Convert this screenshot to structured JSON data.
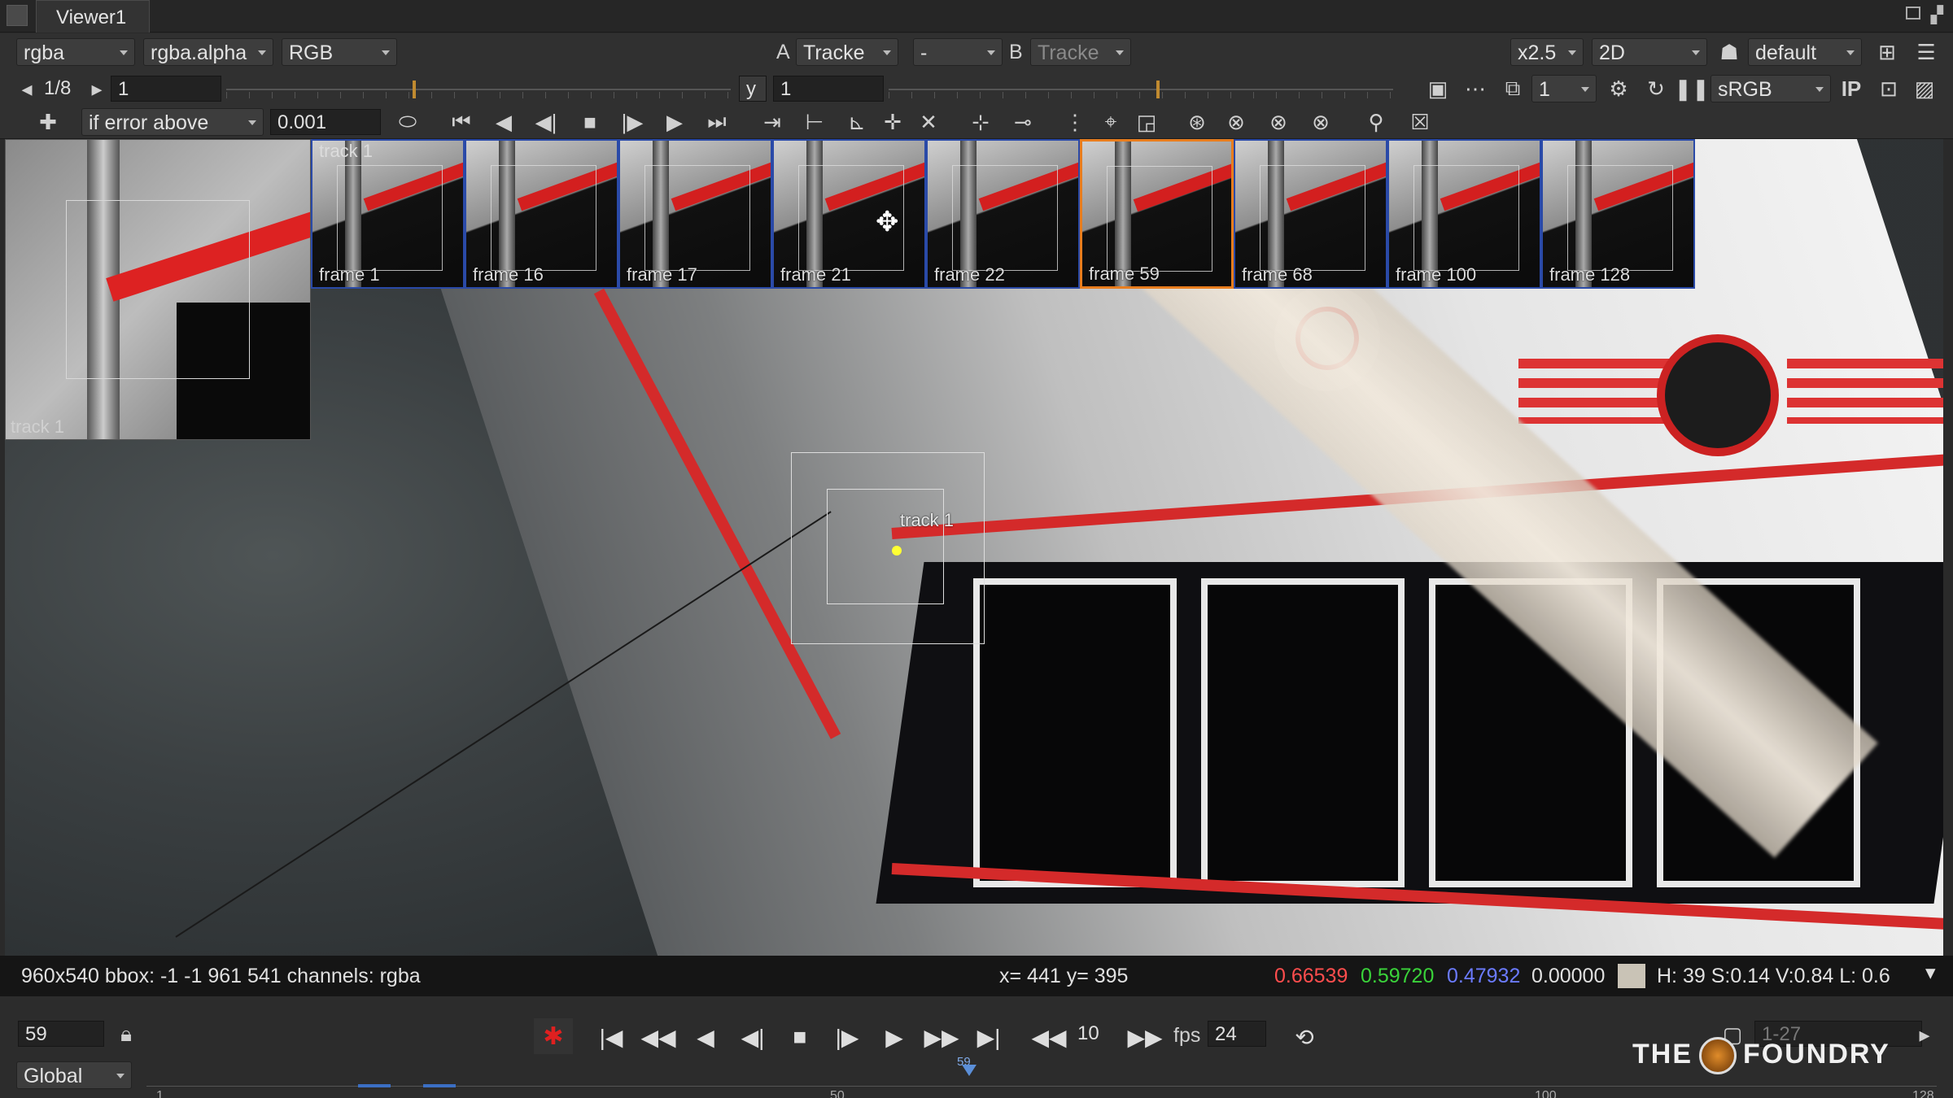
{
  "window": {
    "title": "Viewer1"
  },
  "row1": {
    "channels": "rgba",
    "alpha_channel": "rgba.alpha",
    "color_space": "RGB",
    "input_a_label": "A",
    "input_a_value": "Tracke",
    "operation": "-",
    "input_b_label": "B",
    "input_b_value": "Tracke",
    "zoom": "x2.5",
    "view_mode": "2D",
    "lut": "default"
  },
  "row2": {
    "proxy": "1/8",
    "frame_offset": "1",
    "gamma_label": "y",
    "gamma_value": "1",
    "gain_value": "1",
    "display_lut": "sRGB",
    "ip_label": "IP",
    "gain_level": 0.37,
    "gamma_level": 0.53
  },
  "row3": {
    "error_mode": "if error above",
    "error_threshold": "0.001"
  },
  "viewer": {
    "inset_label": "track 1",
    "track_label": "track 1",
    "keyframes": [
      {
        "caption": "frame 1",
        "track": "track 1",
        "selected": false
      },
      {
        "caption": "frame 16",
        "track": "",
        "selected": false
      },
      {
        "caption": "frame 17",
        "track": "",
        "selected": false
      },
      {
        "caption": "frame 21",
        "track": "",
        "selected": false
      },
      {
        "caption": "frame 22",
        "track": "",
        "selected": false
      },
      {
        "caption": "frame 59",
        "track": "",
        "selected": true
      },
      {
        "caption": "frame 68",
        "track": "",
        "selected": false
      },
      {
        "caption": "frame 100",
        "track": "",
        "selected": false
      },
      {
        "caption": "frame 128",
        "track": "",
        "selected": false
      }
    ]
  },
  "infobar": {
    "format": "960x540 bbox: -1 -1 961 541 channels: rgba",
    "coords": "x= 441 y= 395",
    "r": "0.66539",
    "g": "0.59720",
    "b": "0.47932",
    "a": "0.00000",
    "hsvl": "H: 39 S:0.14 V:0.84  L: 0.6",
    "colors": {
      "r": "#ff4d4d",
      "g": "#3ad33a",
      "b": "#6b7bff"
    }
  },
  "playback": {
    "current_frame": "59",
    "skip_frames": "10",
    "fps_label": "fps",
    "fps_value": "24",
    "range": "1-27",
    "scope": "Global",
    "ticks": [
      "1",
      "50",
      "100",
      "128"
    ],
    "cursor_frame": "59",
    "end_frame_label": "128"
  },
  "branding": {
    "logo_left": "THE",
    "logo_right": "FOUNDRY"
  }
}
